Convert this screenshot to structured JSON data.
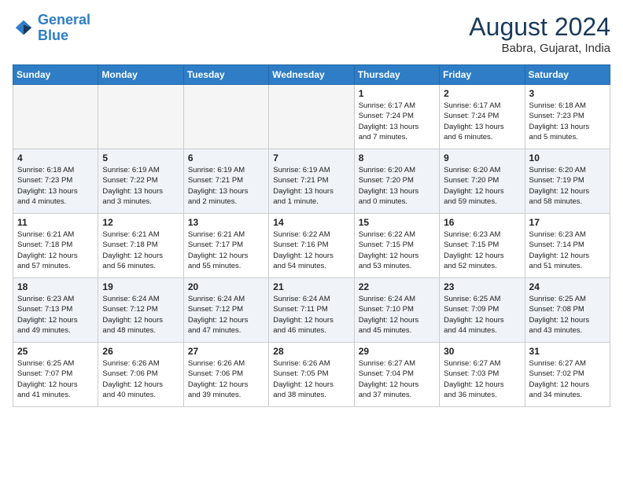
{
  "header": {
    "logo_line1": "General",
    "logo_line2": "Blue",
    "month_year": "August 2024",
    "location": "Babra, Gujarat, India"
  },
  "weekdays": [
    "Sunday",
    "Monday",
    "Tuesday",
    "Wednesday",
    "Thursday",
    "Friday",
    "Saturday"
  ],
  "weeks": [
    [
      {
        "day": "",
        "content": ""
      },
      {
        "day": "",
        "content": ""
      },
      {
        "day": "",
        "content": ""
      },
      {
        "day": "",
        "content": ""
      },
      {
        "day": "1",
        "content": "Sunrise: 6:17 AM\nSunset: 7:24 PM\nDaylight: 13 hours\nand 7 minutes."
      },
      {
        "day": "2",
        "content": "Sunrise: 6:17 AM\nSunset: 7:24 PM\nDaylight: 13 hours\nand 6 minutes."
      },
      {
        "day": "3",
        "content": "Sunrise: 6:18 AM\nSunset: 7:23 PM\nDaylight: 13 hours\nand 5 minutes."
      }
    ],
    [
      {
        "day": "4",
        "content": "Sunrise: 6:18 AM\nSunset: 7:23 PM\nDaylight: 13 hours\nand 4 minutes."
      },
      {
        "day": "5",
        "content": "Sunrise: 6:19 AM\nSunset: 7:22 PM\nDaylight: 13 hours\nand 3 minutes."
      },
      {
        "day": "6",
        "content": "Sunrise: 6:19 AM\nSunset: 7:21 PM\nDaylight: 13 hours\nand 2 minutes."
      },
      {
        "day": "7",
        "content": "Sunrise: 6:19 AM\nSunset: 7:21 PM\nDaylight: 13 hours\nand 1 minute."
      },
      {
        "day": "8",
        "content": "Sunrise: 6:20 AM\nSunset: 7:20 PM\nDaylight: 13 hours\nand 0 minutes."
      },
      {
        "day": "9",
        "content": "Sunrise: 6:20 AM\nSunset: 7:20 PM\nDaylight: 12 hours\nand 59 minutes."
      },
      {
        "day": "10",
        "content": "Sunrise: 6:20 AM\nSunset: 7:19 PM\nDaylight: 12 hours\nand 58 minutes."
      }
    ],
    [
      {
        "day": "11",
        "content": "Sunrise: 6:21 AM\nSunset: 7:18 PM\nDaylight: 12 hours\nand 57 minutes."
      },
      {
        "day": "12",
        "content": "Sunrise: 6:21 AM\nSunset: 7:18 PM\nDaylight: 12 hours\nand 56 minutes."
      },
      {
        "day": "13",
        "content": "Sunrise: 6:21 AM\nSunset: 7:17 PM\nDaylight: 12 hours\nand 55 minutes."
      },
      {
        "day": "14",
        "content": "Sunrise: 6:22 AM\nSunset: 7:16 PM\nDaylight: 12 hours\nand 54 minutes."
      },
      {
        "day": "15",
        "content": "Sunrise: 6:22 AM\nSunset: 7:15 PM\nDaylight: 12 hours\nand 53 minutes."
      },
      {
        "day": "16",
        "content": "Sunrise: 6:23 AM\nSunset: 7:15 PM\nDaylight: 12 hours\nand 52 minutes."
      },
      {
        "day": "17",
        "content": "Sunrise: 6:23 AM\nSunset: 7:14 PM\nDaylight: 12 hours\nand 51 minutes."
      }
    ],
    [
      {
        "day": "18",
        "content": "Sunrise: 6:23 AM\nSunset: 7:13 PM\nDaylight: 12 hours\nand 49 minutes."
      },
      {
        "day": "19",
        "content": "Sunrise: 6:24 AM\nSunset: 7:12 PM\nDaylight: 12 hours\nand 48 minutes."
      },
      {
        "day": "20",
        "content": "Sunrise: 6:24 AM\nSunset: 7:12 PM\nDaylight: 12 hours\nand 47 minutes."
      },
      {
        "day": "21",
        "content": "Sunrise: 6:24 AM\nSunset: 7:11 PM\nDaylight: 12 hours\nand 46 minutes."
      },
      {
        "day": "22",
        "content": "Sunrise: 6:24 AM\nSunset: 7:10 PM\nDaylight: 12 hours\nand 45 minutes."
      },
      {
        "day": "23",
        "content": "Sunrise: 6:25 AM\nSunset: 7:09 PM\nDaylight: 12 hours\nand 44 minutes."
      },
      {
        "day": "24",
        "content": "Sunrise: 6:25 AM\nSunset: 7:08 PM\nDaylight: 12 hours\nand 43 minutes."
      }
    ],
    [
      {
        "day": "25",
        "content": "Sunrise: 6:25 AM\nSunset: 7:07 PM\nDaylight: 12 hours\nand 41 minutes."
      },
      {
        "day": "26",
        "content": "Sunrise: 6:26 AM\nSunset: 7:06 PM\nDaylight: 12 hours\nand 40 minutes."
      },
      {
        "day": "27",
        "content": "Sunrise: 6:26 AM\nSunset: 7:06 PM\nDaylight: 12 hours\nand 39 minutes."
      },
      {
        "day": "28",
        "content": "Sunrise: 6:26 AM\nSunset: 7:05 PM\nDaylight: 12 hours\nand 38 minutes."
      },
      {
        "day": "29",
        "content": "Sunrise: 6:27 AM\nSunset: 7:04 PM\nDaylight: 12 hours\nand 37 minutes."
      },
      {
        "day": "30",
        "content": "Sunrise: 6:27 AM\nSunset: 7:03 PM\nDaylight: 12 hours\nand 36 minutes."
      },
      {
        "day": "31",
        "content": "Sunrise: 6:27 AM\nSunset: 7:02 PM\nDaylight: 12 hours\nand 34 minutes."
      }
    ]
  ]
}
